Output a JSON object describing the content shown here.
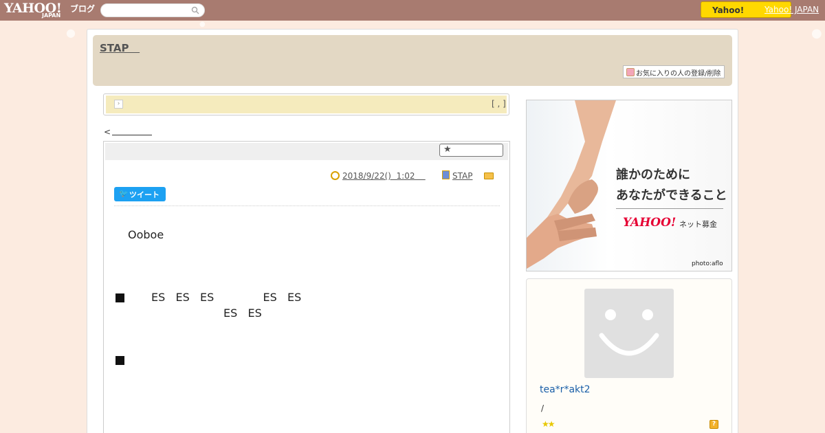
{
  "topbar": {
    "logo_text": "YAHOO!",
    "logo_sub": "JAPAN",
    "logo_blog": "ブログ",
    "search_placeholder": "",
    "yahoo_button_label": "Yahoo!",
    "yahoo_japan_link": "Yahoo! JAPAN"
  },
  "header": {
    "blog_title": "STAP   ",
    "favorite_button_label": "お気に入りの人の登録/削除"
  },
  "notice": {
    "date_text": "[ , ]"
  },
  "navigation": {
    "prev_label": "<"
  },
  "article": {
    "date_link": "2018/9/22()  1:02    ",
    "category_link": "STAP",
    "tweet_label": "ツイート",
    "paragraphs": [
      "Ooboe",
      "ES   ES   ES              ES   ES",
      "ES   ES"
    ],
    "bullets": [
      "■",
      "■"
    ]
  },
  "ad": {
    "line1": "誰かのために",
    "line2": "あなたができること",
    "logo": "YAHOO!",
    "logo_sub_text": "ネット募金",
    "credit": "photo:aflo"
  },
  "profile": {
    "nickname": "tea*r*akt2",
    "separator": "/",
    "stars": "★★",
    "question_label": "?"
  },
  "colors": {
    "topbar": "#a87b70",
    "header": "#e3d8c4",
    "notice": "#f5ebbd",
    "tweet": "#1da1f2",
    "link": "#1a5fa8"
  }
}
